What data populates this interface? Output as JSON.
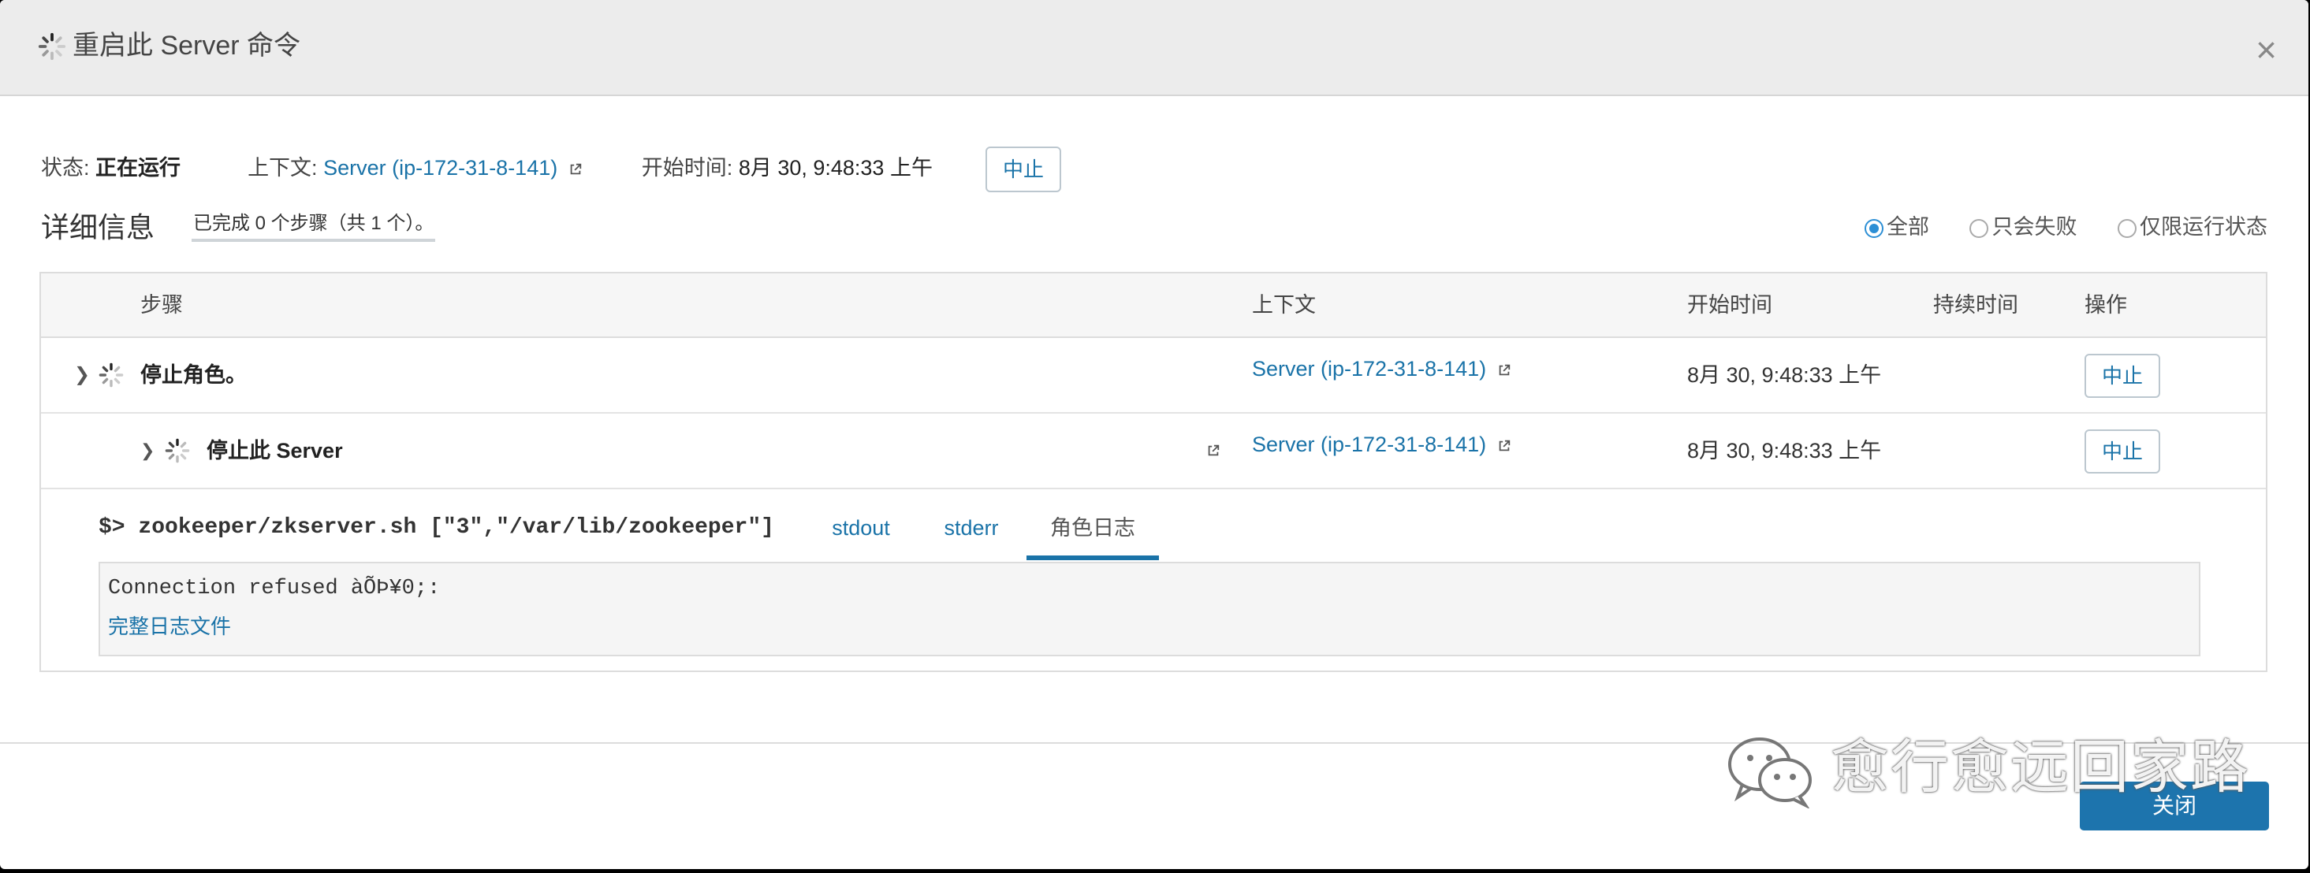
{
  "dialog": {
    "title": "重启此 Server 命令",
    "close_symbol": "×"
  },
  "summary": {
    "status_label": "状态:",
    "status_value": "正在运行",
    "context_label": "上下文:",
    "context_value": "Server (ip-172-31-8-141)",
    "start_label": "开始时间:",
    "start_value": "8月 30, 9:48:33 上午",
    "abort_label": "中止"
  },
  "details": {
    "title": "详细信息",
    "progress": "已完成 0 个步骤（共 1 个）。",
    "filters": [
      "全部",
      "只会失败",
      "仅限运行状态"
    ],
    "selected_filter": "全部"
  },
  "table": {
    "headers": {
      "step": "步骤",
      "context": "上下文",
      "start": "开始时间",
      "duration": "持续时间",
      "action": "操作"
    },
    "rows": [
      {
        "step": "停止角色。",
        "context": "Server (ip-172-31-8-141)",
        "start": "8月 30, 9:48:33 上午",
        "duration": "",
        "action": "中止"
      },
      {
        "step": "停止此 Server",
        "context": "Server (ip-172-31-8-141)",
        "start": "8月 30, 9:48:33 上午",
        "duration": "",
        "action": "中止"
      }
    ]
  },
  "command": {
    "text": "$> zookeeper/zkserver.sh [\"3\",\"/var/lib/zookeeper\"]",
    "tabs": [
      "stdout",
      "stderr",
      "角色日志"
    ],
    "active_tab": "角色日志",
    "log_line": "Connection refused àÕÞ¥0;:",
    "full_log_link": "完整日志文件"
  },
  "footer": {
    "close_label": "关闭",
    "watermark": "愈行愈远回家路"
  },
  "colors": {
    "link": "#1a73a8",
    "primary_button": "#1d74ad",
    "radio_selected": "#2d8fd5",
    "header_bg": "#ececec"
  }
}
